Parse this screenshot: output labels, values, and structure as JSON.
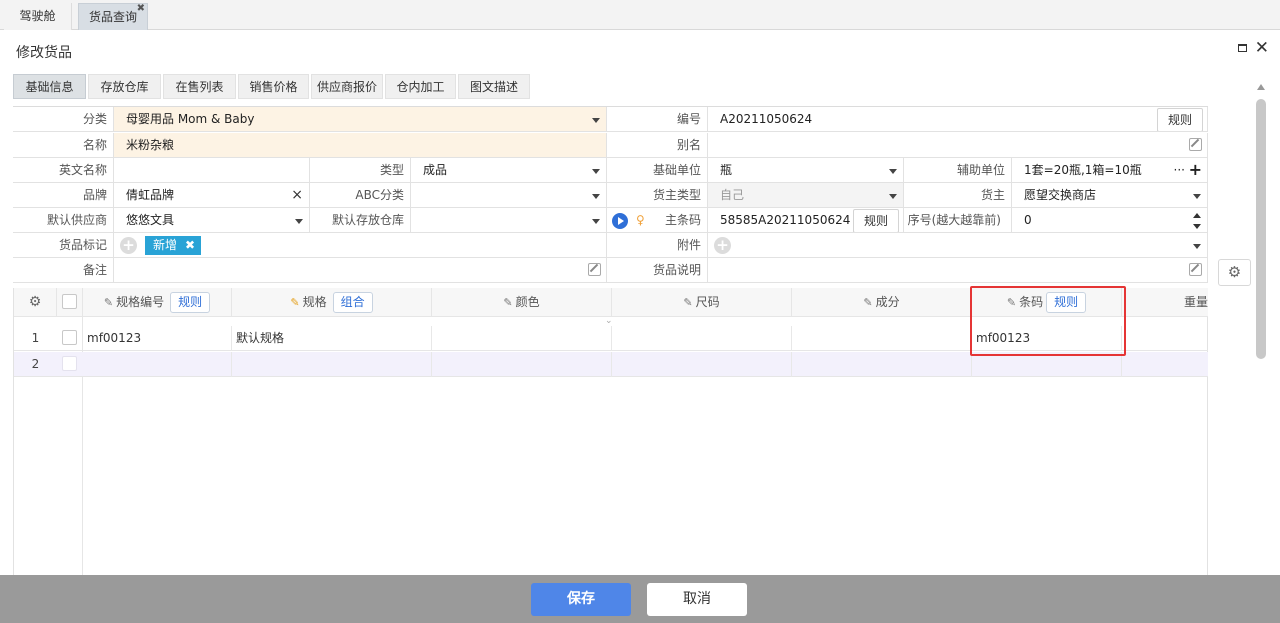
{
  "top_tabs": [
    {
      "label": "驾驶舱"
    },
    {
      "label": "货品查询",
      "close": "✖"
    }
  ],
  "dialog": {
    "title": "修改货品"
  },
  "sub_tabs": [
    "基础信息",
    "存放仓库",
    "在售列表",
    "销售价格",
    "供应商报价",
    "仓内加工",
    "图文描述"
  ],
  "form": {
    "category_label": "分类",
    "category_value": "母婴用品 Mom & Baby",
    "code_label": "编号",
    "code_value": "A20211050624",
    "rule_btn": "规则",
    "name_label": "名称",
    "name_value": "米粉杂粮",
    "alias_label": "别名",
    "en_name_label": "英文名称",
    "type_label": "类型",
    "type_value": "成品",
    "base_unit_label": "基础单位",
    "base_unit_value": "瓶",
    "aux_unit_label": "辅助单位",
    "aux_unit_value": "1套=20瓶,1箱=10瓶",
    "aux_unit_more": "···",
    "aux_unit_add": "+",
    "brand_label": "品牌",
    "brand_value": "倩虹品牌",
    "brand_clear": "×",
    "abc_label": "ABC分类",
    "owner_type_label": "货主类型",
    "owner_type_value": "自己",
    "owner_label": "货主",
    "owner_value": "愿望交换商店",
    "supplier_label": "默认供应商",
    "supplier_value": "悠悠文具",
    "warehouse_label": "默认存放仓库",
    "barcode_label": "主条码",
    "barcode_value": "58585A20211050624",
    "barcode_rule_btn": "规则",
    "seq_label": "序号(越大越靠前)",
    "seq_value": "0",
    "tag_label": "货品标记",
    "tag_value": "新增",
    "tag_remove": "✖",
    "attach_label": "附件",
    "remark_label": "备注",
    "desc_label": "货品说明",
    "plus": "+"
  },
  "grid": {
    "columns": [
      {
        "label": "规格编号",
        "btn": "规则"
      },
      {
        "label": "规格",
        "btn": "组合"
      },
      {
        "label": "颜色"
      },
      {
        "label": "尺码"
      },
      {
        "label": "成分"
      },
      {
        "label": "条码",
        "btn": "规则"
      },
      {
        "label": "重量"
      }
    ],
    "rows": [
      {
        "num": "1",
        "spec_code": "mf00123",
        "spec": "默认规格",
        "barcode": "mf00123"
      },
      {
        "num": "2",
        "spec_code": "",
        "spec": "",
        "barcode": ""
      }
    ]
  },
  "icons": {
    "gear": "⚙",
    "pencil": "✎",
    "close": "✕",
    "pin": "📍"
  },
  "footer": {
    "save": "保存",
    "cancel": "取消"
  },
  "colors": {
    "primary": "#4f86e8",
    "required_bg": "#fdf3e4",
    "tag": "#29a3d6",
    "highlight": "#e53535"
  }
}
